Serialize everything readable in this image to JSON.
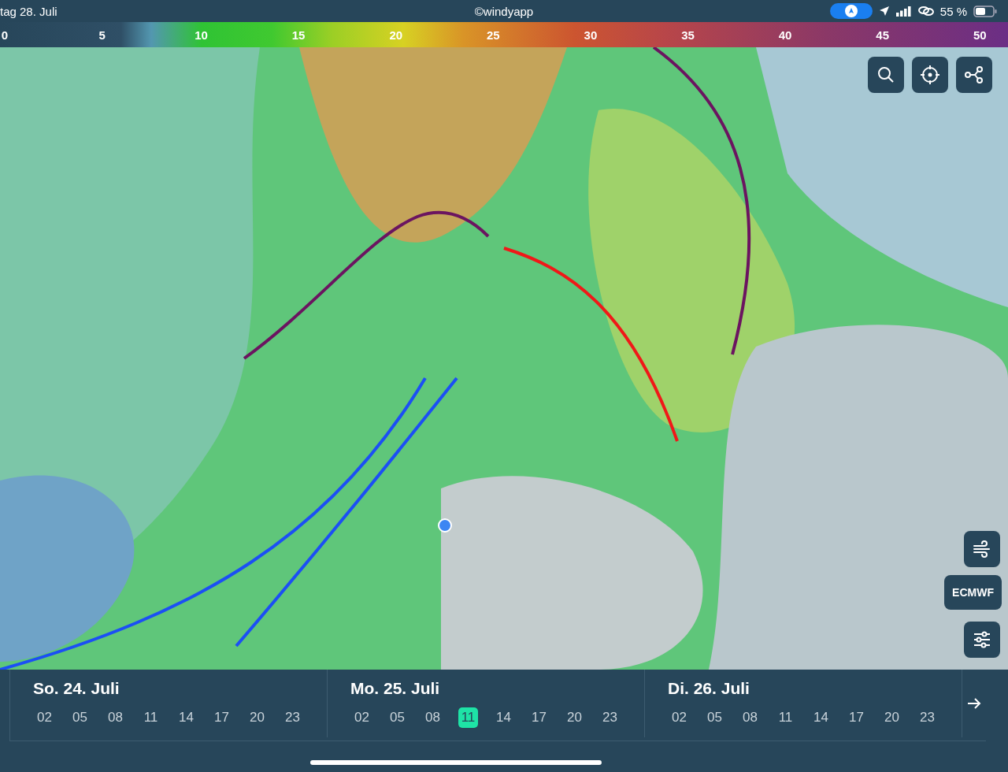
{
  "status_bar": {
    "date": "tag 28. Juli",
    "center": "©windyapp",
    "battery": "55 %"
  },
  "legend": {
    "labels": [
      "0",
      "5",
      "10",
      "15",
      "20",
      "25",
      "30",
      "35",
      "40",
      "45",
      "50"
    ]
  },
  "map": {
    "model": "ECMWF"
  },
  "days": [
    {
      "title": "So. 24. Juli",
      "hours": [
        {
          "label": "02",
          "selected": false
        },
        {
          "label": "05",
          "selected": false
        },
        {
          "label": "08",
          "selected": false
        },
        {
          "label": "11",
          "selected": false
        },
        {
          "label": "14",
          "selected": false
        },
        {
          "label": "17",
          "selected": false
        },
        {
          "label": "20",
          "selected": false
        },
        {
          "label": "23",
          "selected": false
        }
      ]
    },
    {
      "title": "Mo. 25. Juli",
      "hours": [
        {
          "label": "02",
          "selected": false
        },
        {
          "label": "05",
          "selected": false
        },
        {
          "label": "08",
          "selected": false
        },
        {
          "label": "11",
          "selected": true
        },
        {
          "label": "14",
          "selected": false
        },
        {
          "label": "17",
          "selected": false
        },
        {
          "label": "20",
          "selected": false
        },
        {
          "label": "23",
          "selected": false
        }
      ]
    },
    {
      "title": "Di. 26. Juli",
      "hours": [
        {
          "label": "02",
          "selected": false
        },
        {
          "label": "05",
          "selected": false
        },
        {
          "label": "08",
          "selected": false
        },
        {
          "label": "11",
          "selected": false
        },
        {
          "label": "14",
          "selected": false
        },
        {
          "label": "17",
          "selected": false
        },
        {
          "label": "20",
          "selected": false
        },
        {
          "label": "23",
          "selected": false
        }
      ]
    }
  ]
}
